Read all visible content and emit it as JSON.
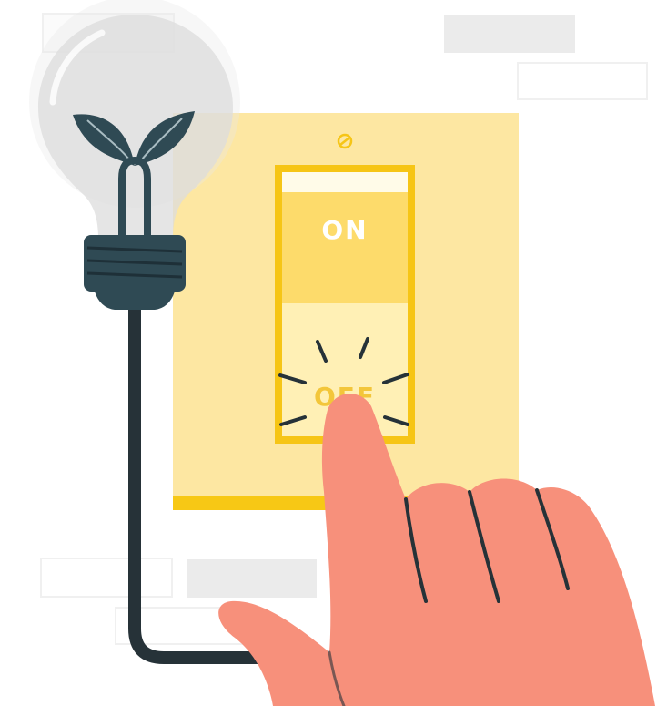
{
  "switch": {
    "on_label": "ON",
    "off_label": "OFF"
  },
  "colors": {
    "panel": "#fde7a2",
    "panel_base": "#f7c815",
    "switch_frame": "#f6c516",
    "switch_on": "#fddb6b",
    "switch_off": "#fff0b5",
    "switch_text": "#ffffff",
    "off_text": "#f3c63a",
    "bulb_glass": "#e7e7e7",
    "bulb_dark": "#2f4a54",
    "cable": "#263238",
    "hand": "#f7907b",
    "hand_outline": "#263238",
    "placeholder_fill": "#ebebeb",
    "placeholder_border": "#eeeeee"
  },
  "icons": {
    "bulb": "lightbulb-with-sprout-icon",
    "screw": "screw-icon",
    "hand": "pointing-hand-icon"
  }
}
